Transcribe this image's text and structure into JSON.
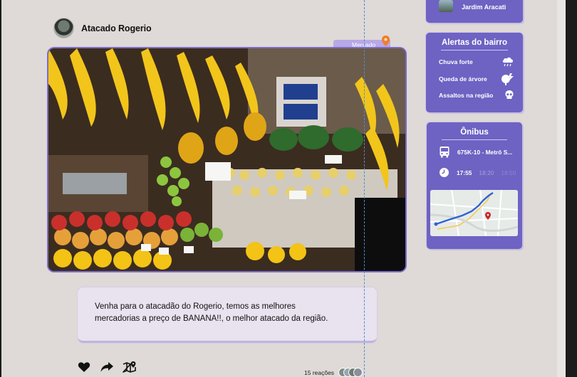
{
  "post": {
    "author": "Atacado Rogerio",
    "tag": "Mercado",
    "caption_line1": "Venha para o atacadão do Rogerio, temos as melhores",
    "caption_line2": "mercadorias a preço de BANANA!!, o melhor atacado da região.",
    "reactions": "15 reações"
  },
  "sidebar": {
    "location": "Jardim Aracati",
    "alerts": {
      "title": "Alertas do bairro",
      "items": [
        {
          "label": "Chuva forte",
          "icon": "rain-cloud-icon"
        },
        {
          "label": "Queda de árvore",
          "icon": "falling-tree-icon"
        },
        {
          "label": "Assaltos na região",
          "icon": "skull-icon"
        }
      ]
    },
    "bus": {
      "title": "Ônibus",
      "line": "675K-10 - Metrô S...",
      "times": [
        "17:55",
        "18:20",
        "18:50"
      ]
    }
  },
  "colors": {
    "background": "#dfd9d7",
    "card": "#6e62c3",
    "caption_bg": "#e9e2ef",
    "tag_bg": "#b8a8e6",
    "pin": "#f07d2c"
  }
}
